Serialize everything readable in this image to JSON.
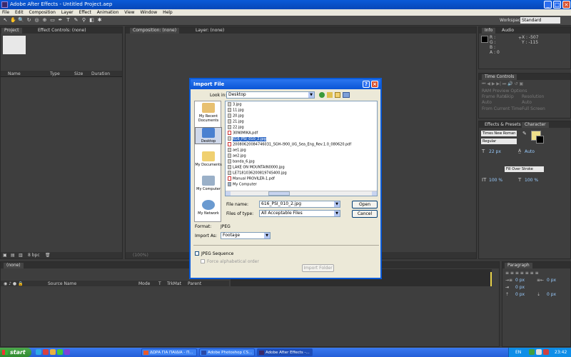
{
  "window": {
    "title": "Adobe After Effects - Untitled Project.aep"
  },
  "menu": [
    "File",
    "Edit",
    "Composition",
    "Layer",
    "Effect",
    "Animation",
    "View",
    "Window",
    "Help"
  ],
  "workspace": {
    "label": "Workspace:",
    "value": "Standard"
  },
  "panels": {
    "project_tab": "Project",
    "effect_controls_tab": "Effect Controls: (none)",
    "project_columns": [
      "Name",
      "Type",
      "Size",
      "Duration"
    ],
    "project_bpc": "8 bpc",
    "composition_tab": "Composition: (none)",
    "layer_tab": "Layer: (none)",
    "comp_zoom": "(100%)",
    "info_tab": "Info",
    "audio_tab": "Audio",
    "info_r": "R :",
    "info_g": "G :",
    "info_b": "B :",
    "info_a": "A : 0",
    "info_x": "X : -507",
    "info_y": "Y : -115",
    "time_controls_tab": "Time Controls",
    "ram_preview": "RAM Preview Options",
    "frame_rate_label": "Frame Rate",
    "skip_label": "Skip",
    "resolution_label": "Resolution",
    "frame_rate_value": "Auto",
    "resolution_value": "Auto",
    "from_current": "From Current Time",
    "full_screen": "Full Screen",
    "effects_presets_tab": "Effects & Presets",
    "character_tab": "Character",
    "font_family": "Times New Roman",
    "font_style": "Regular",
    "font_size": "22 px",
    "leading": "Auto",
    "fill_over_stroke": "Fill Over Stroke",
    "scale_v": "100 %",
    "scale_h": "100 %",
    "timeline_tab": "(none)",
    "timeline_columns": [
      "Source Name",
      "Mode",
      "T",
      "TrkMat",
      "Parent"
    ],
    "paragraph_tab": "Paragraph",
    "para_px": [
      "0 px",
      "0 px",
      "0 px",
      "0 px",
      "0 px"
    ]
  },
  "dialog": {
    "title": "Import File",
    "look_in_label": "Look in:",
    "look_in_value": "Desktop",
    "places": [
      "My Recent Documents",
      "Desktop",
      "My Documents",
      "My Computer",
      "My Network"
    ],
    "files": [
      "3.jpg",
      "11.jpg",
      "20.jpg",
      "21.jpg",
      "22.jpg",
      "30N0MIKA.pdf",
      "616_PSI_010_2.jpg",
      "20080620084746031_SGH-i900_UG_Sea_Eng_Rev.1.0_080620.pdf",
      "ae1.jpg",
      "ae2.jpg",
      "banda_6.jpg",
      "LAKE ON MOUNTAIN0000.jpg",
      "LE718103620081974S400.jpg",
      "Manual PROVILER-1.pdf",
      "My Computer"
    ],
    "selected_index": 6,
    "file_name_label": "File name:",
    "file_name_value": "616_PSI_010_2.jpg",
    "files_of_type_label": "Files of type:",
    "files_of_type_value": "All Acceptable Files",
    "open_button": "Open",
    "cancel_button": "Cancel",
    "format_label": "Format:",
    "format_value": "JPEG",
    "import_as_label": "Import As:",
    "import_as_value": "Footage",
    "jpeg_sequence": "JPEG Sequence",
    "force_alpha": "Force alphabetical order",
    "import_folder_button": "Import Folder"
  },
  "taskbar": {
    "start": "start",
    "tasks": [
      "ΔΩΡΑ ΓΙΑ ΠΑΙΔΙΑ - Π...",
      "Adobe Photoshop CS...",
      "Adobe After Effects -..."
    ],
    "language": "EN",
    "clock": "23:42"
  }
}
